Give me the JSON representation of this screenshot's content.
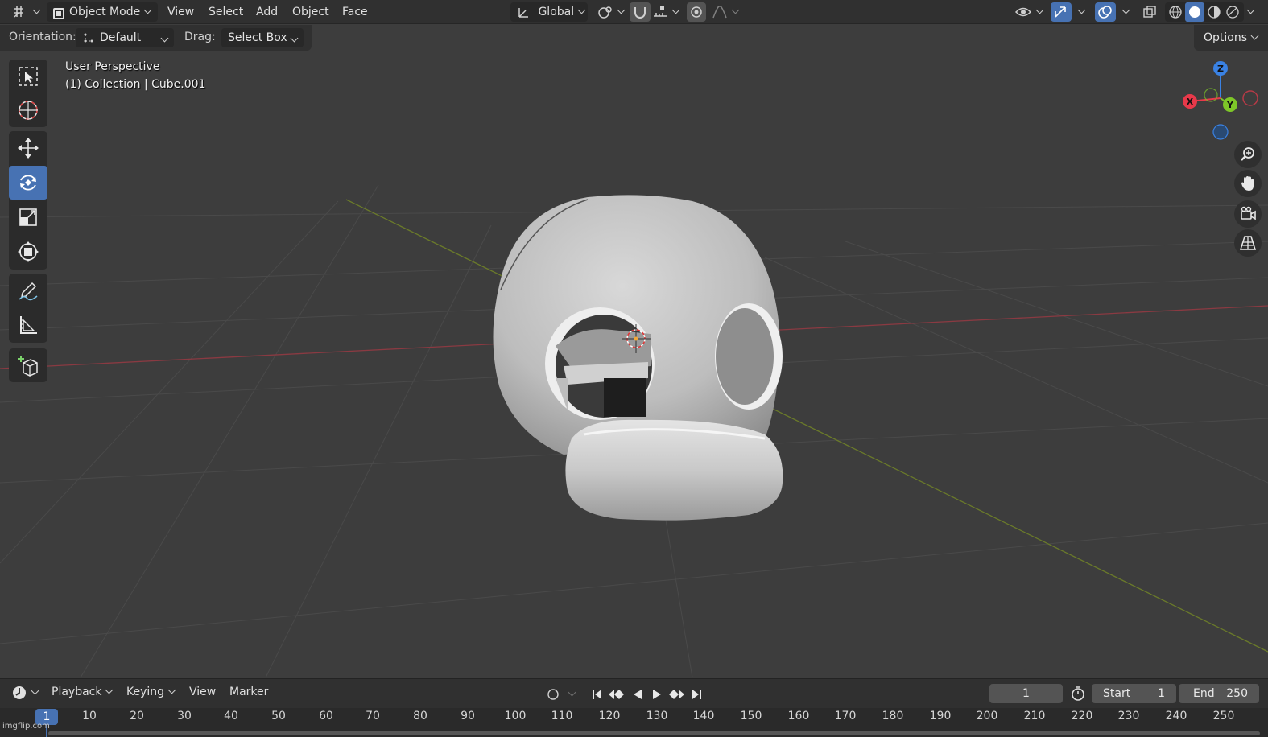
{
  "header": {
    "mode": "Object Mode",
    "menus": [
      "View",
      "Select",
      "Add",
      "Object",
      "Face"
    ],
    "orientation": "Global"
  },
  "toolrow": {
    "orientation_label": "Orientation:",
    "orientation_value": "Default",
    "drag_label": "Drag:",
    "drag_value": "Select Box",
    "options_label": "Options"
  },
  "viewport": {
    "perspective": "User Perspective",
    "collection": "(1) Collection | Cube.001",
    "gizmo_axes": [
      "Z",
      "X",
      "Y"
    ]
  },
  "toolbar": {
    "tools": [
      "select-box",
      "cursor",
      "move",
      "rotate",
      "scale",
      "transform",
      "annotate",
      "measure",
      "add-cube"
    ],
    "active_tool": "rotate"
  },
  "timeline": {
    "menus": [
      "Playback",
      "Keying",
      "View",
      "Marker"
    ],
    "current_frame": "1",
    "start_label": "Start",
    "start_value": "1",
    "end_label": "End",
    "end_value": "250",
    "ruler_current": "1",
    "ruler_ticks": [
      "10",
      "20",
      "30",
      "40",
      "50",
      "60",
      "70",
      "80",
      "90",
      "100",
      "110",
      "120",
      "130",
      "140",
      "150",
      "160",
      "170",
      "180",
      "190",
      "200",
      "210",
      "220",
      "230",
      "240",
      "250"
    ]
  },
  "watermark": "imgflip.com",
  "colors": {
    "accent": "#4772b3",
    "x_axis": "#e8394a",
    "y_axis": "#7ec728",
    "z_axis": "#3a82e4"
  }
}
